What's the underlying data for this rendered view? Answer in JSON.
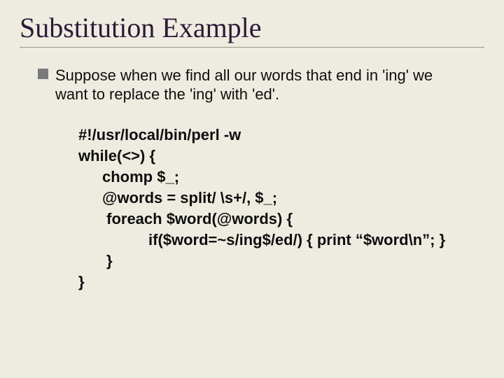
{
  "title": "Substitution Example",
  "bullet": {
    "text": "Suppose when we find all our words that end in 'ing' we want to replace the 'ing' with 'ed'."
  },
  "code": {
    "l1": "#!/usr/local/bin/perl -w",
    "l2": "while(<>) {",
    "l3": "chomp $_;",
    "l4": "@words = split/ \\s+/, $_;",
    "l5": " foreach $word(@words) {",
    "l6": "if($word=~s/ing$/ed/) { print “$word\\n”; }",
    "l7": "}",
    "l8": "}"
  }
}
